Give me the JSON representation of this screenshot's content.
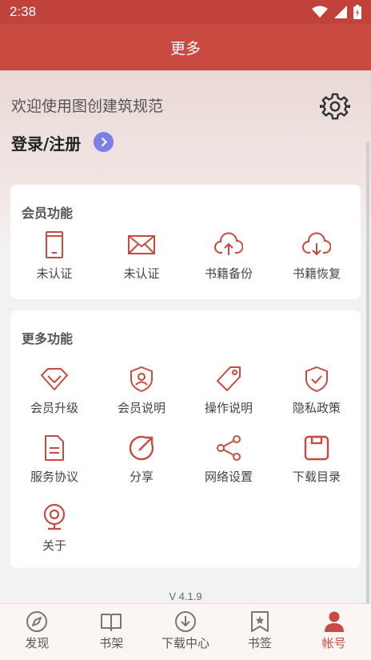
{
  "status_bar": {
    "time": "2:38"
  },
  "app_bar": {
    "title": "更多"
  },
  "header": {
    "welcome": "欢迎使用图创建筑规范",
    "login": "登录/注册"
  },
  "member_section": {
    "title": "会员功能",
    "items": [
      {
        "label": "未认证",
        "icon": "phone-icon"
      },
      {
        "label": "未认证",
        "icon": "mail-icon"
      },
      {
        "label": "书籍备份",
        "icon": "cloud-upload-icon"
      },
      {
        "label": "书籍恢复",
        "icon": "cloud-download-icon"
      }
    ]
  },
  "more_section": {
    "title": "更多功能",
    "items": [
      {
        "label": "会员升级",
        "icon": "diamond-icon"
      },
      {
        "label": "会员说明",
        "icon": "user-shield-icon"
      },
      {
        "label": "操作说明",
        "icon": "tag-icon"
      },
      {
        "label": "隐私政策",
        "icon": "shield-check-icon"
      },
      {
        "label": "服务协议",
        "icon": "document-icon"
      },
      {
        "label": "分享",
        "icon": "share-arrow-icon"
      },
      {
        "label": "网络设置",
        "icon": "network-icon"
      },
      {
        "label": "下载目录",
        "icon": "folder-icon"
      },
      {
        "label": "关于",
        "icon": "webcam-icon"
      }
    ]
  },
  "version": "V 4.1.9",
  "bottom_nav": {
    "items": [
      {
        "label": "发现",
        "icon": "compass-icon"
      },
      {
        "label": "书架",
        "icon": "book-icon"
      },
      {
        "label": "下载中心",
        "icon": "download-icon"
      },
      {
        "label": "书签",
        "icon": "bookmark-icon"
      },
      {
        "label": "帐号",
        "icon": "person-icon"
      }
    ],
    "active": "帐号"
  },
  "colors": {
    "primary": "#c94a40",
    "accent_badge": "#7b7fe6"
  }
}
